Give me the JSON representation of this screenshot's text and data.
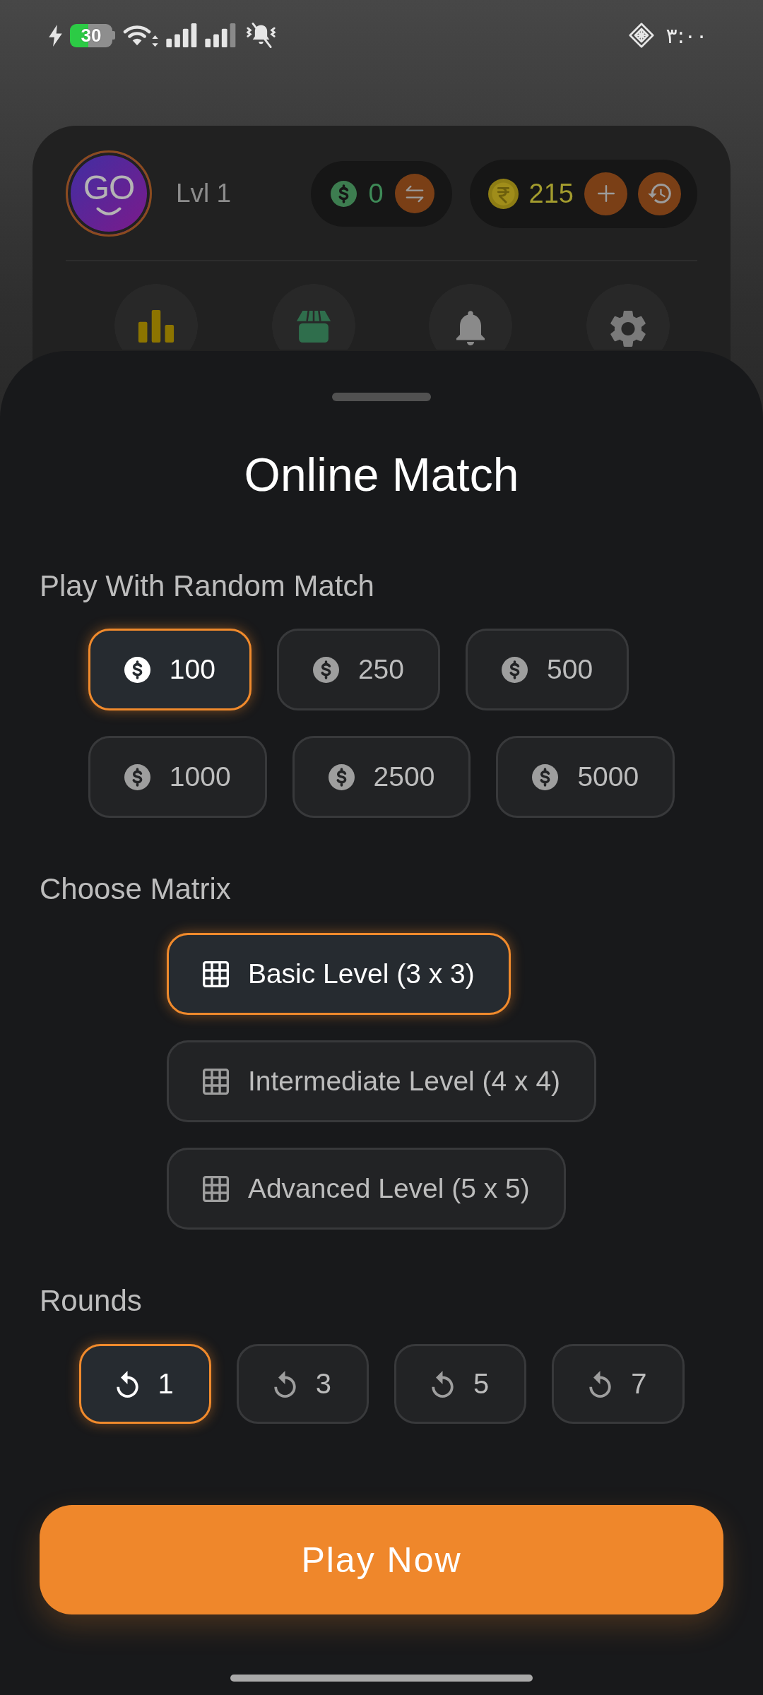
{
  "status_bar": {
    "battery": "30",
    "time": "۳:۰۰"
  },
  "profile": {
    "avatar_text": "GO",
    "level": "Lvl 1",
    "cash": "0",
    "coins": "215"
  },
  "sheet": {
    "title": "Online Match",
    "stake": {
      "label": "Play With Random Match",
      "options": [
        {
          "amount": "100",
          "selected": true
        },
        {
          "amount": "250",
          "selected": false
        },
        {
          "amount": "500",
          "selected": false
        },
        {
          "amount": "1000",
          "selected": false
        },
        {
          "amount": "2500",
          "selected": false
        },
        {
          "amount": "5000",
          "selected": false
        }
      ]
    },
    "matrix": {
      "label": "Choose Matrix",
      "options": [
        {
          "label": "Basic Level (3 x 3)",
          "selected": true
        },
        {
          "label": "Intermediate Level (4 x 4)",
          "selected": false
        },
        {
          "label": "Advanced Level (5 x 5)",
          "selected": false
        }
      ]
    },
    "rounds": {
      "label": "Rounds",
      "options": [
        {
          "count": "1",
          "selected": true
        },
        {
          "count": "3",
          "selected": false
        },
        {
          "count": "5",
          "selected": false
        },
        {
          "count": "7",
          "selected": false
        }
      ]
    },
    "play_button": "Play Now"
  }
}
